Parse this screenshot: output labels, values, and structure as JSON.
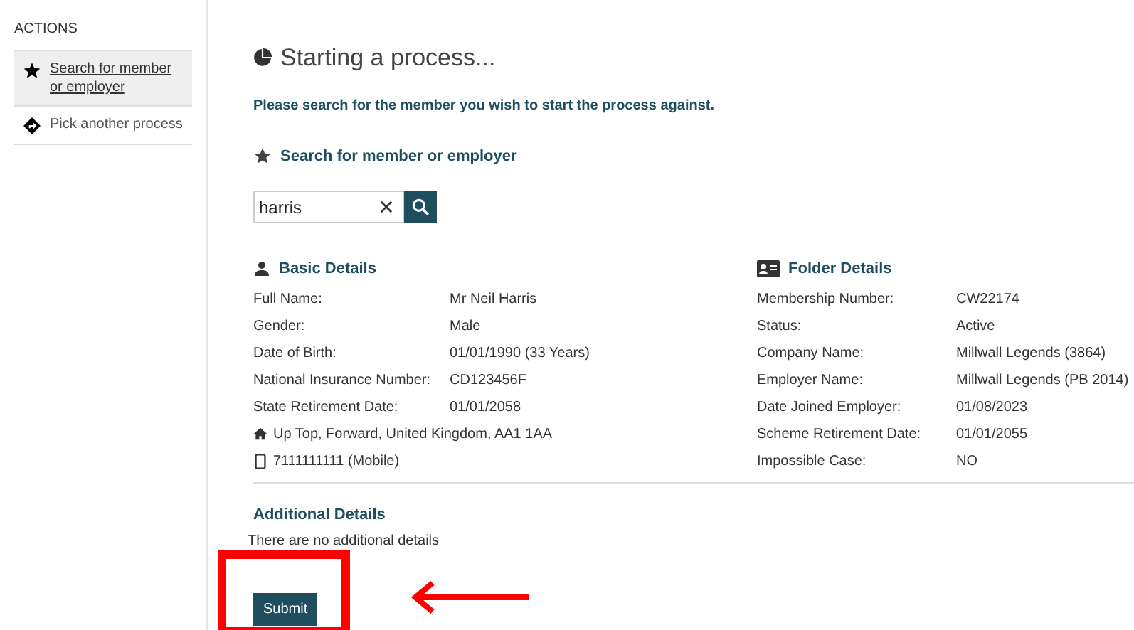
{
  "sidebar": {
    "title": "ACTIONS",
    "items": [
      {
        "label": "Search for member or employer",
        "kind": "star",
        "selected": true
      },
      {
        "label": "Pick another process",
        "kind": "directions",
        "selected": false
      }
    ]
  },
  "page": {
    "title": "Starting a process...",
    "instruction": "Please search for the member you wish to start the process against."
  },
  "search": {
    "heading": "Search for member or employer",
    "value": "harris"
  },
  "basic_details": {
    "heading": "Basic Details",
    "rows": [
      {
        "label": "Full Name:",
        "value": "Mr Neil Harris"
      },
      {
        "label": "Gender:",
        "value": "Male"
      },
      {
        "label": "Date of Birth:",
        "value": "01/01/1990 (33 Years)"
      },
      {
        "label": "National Insurance Number:",
        "value": "CD123456F"
      },
      {
        "label": "State Retirement Date:",
        "value": "01/01/2058"
      }
    ],
    "contacts": [
      {
        "kind": "address",
        "text": "Up Top, Forward, United Kingdom, AA1 1AA"
      },
      {
        "kind": "phone",
        "text": "7111111111 (Mobile)"
      }
    ]
  },
  "folder_details": {
    "heading": "Folder Details",
    "rows": [
      {
        "label": "Membership Number:",
        "value": "CW22174"
      },
      {
        "label": "Status:",
        "value": "Active"
      },
      {
        "label": "Company Name:",
        "value": "Millwall Legends (3864)"
      },
      {
        "label": "Employer Name:",
        "value": "Millwall Legends (PB 2014)"
      },
      {
        "label": "Date Joined Employer:",
        "value": "01/08/2023"
      },
      {
        "label": "Scheme Retirement Date:",
        "value": "01/01/2055"
      },
      {
        "label": "Impossible Case:",
        "value": "NO"
      }
    ]
  },
  "additional_details": {
    "heading": "Additional Details",
    "text": "There are no additional details"
  },
  "submit_button": "Submit"
}
